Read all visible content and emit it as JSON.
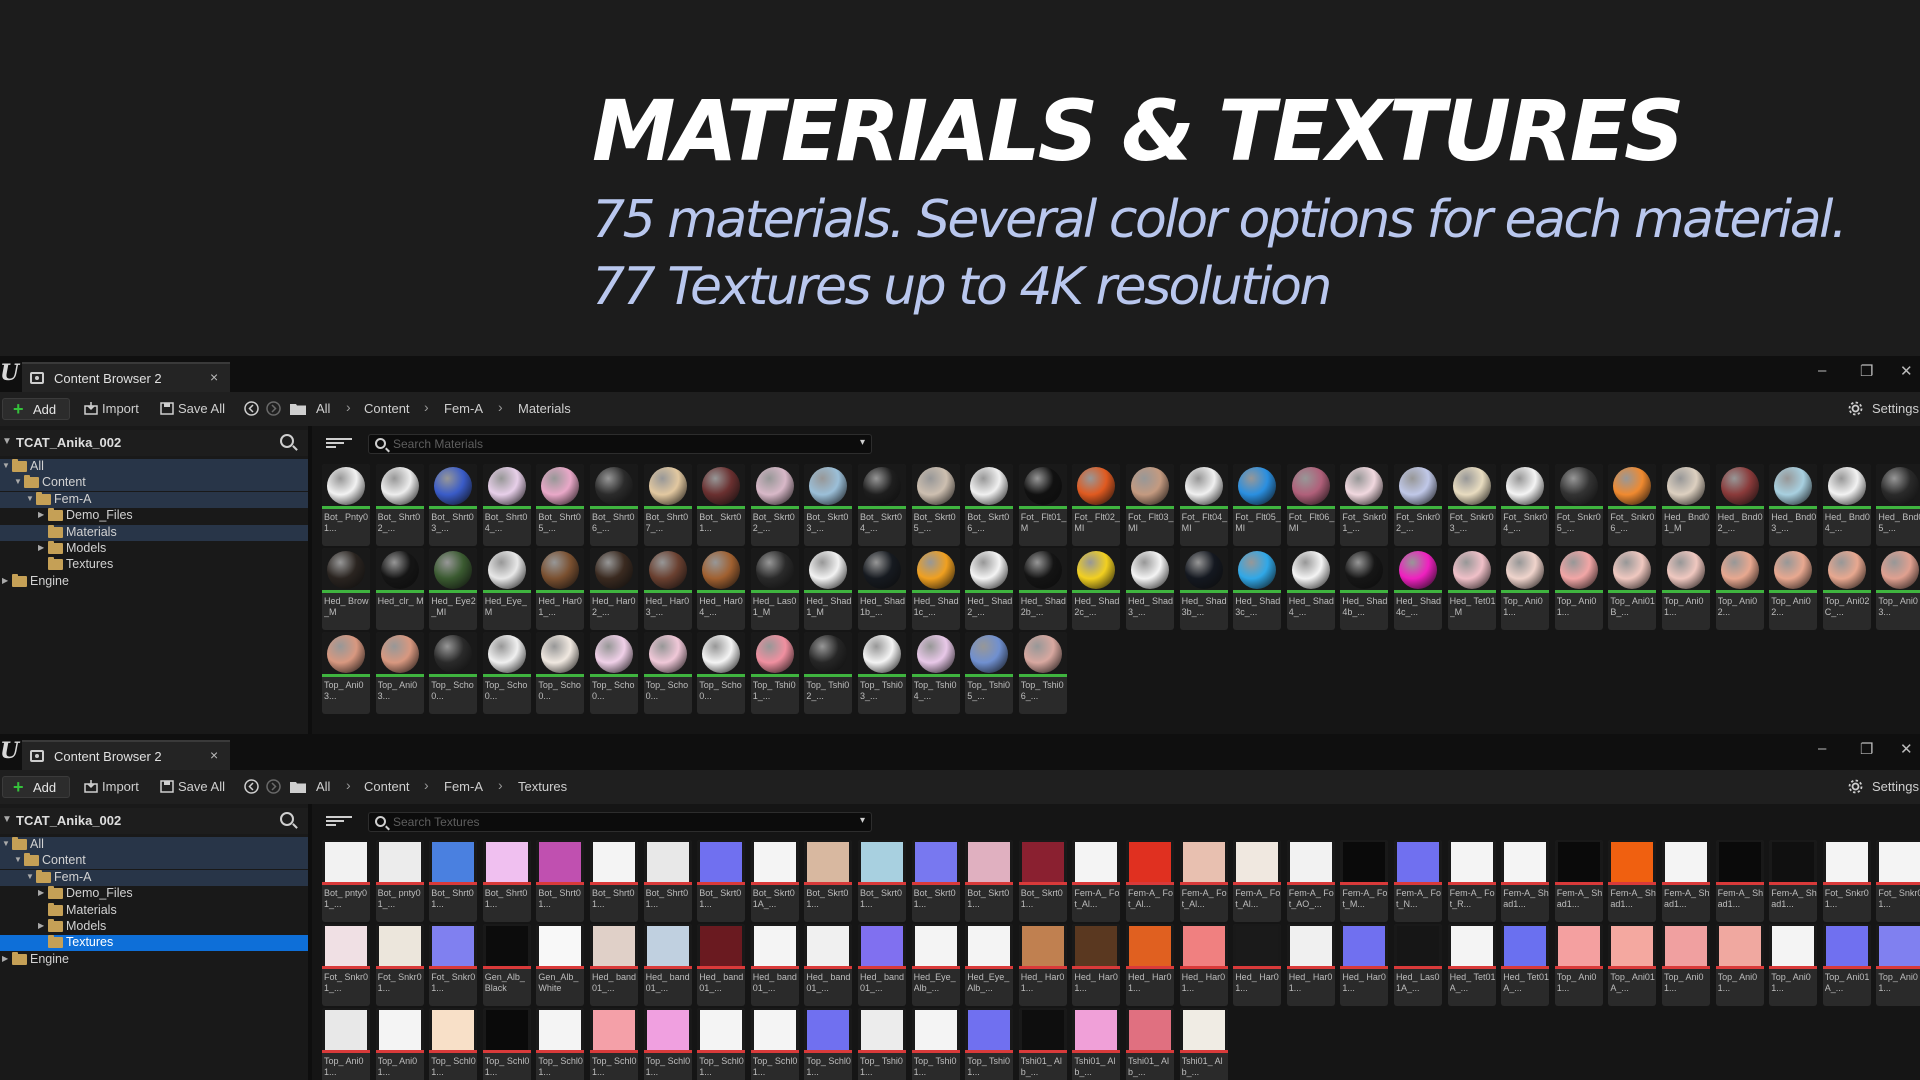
{
  "hero": {
    "title": "MATERIALS & TEXTURES",
    "line1": "75 materials. Several color options for each material.",
    "line2": "77 Textures up to 4K resolution"
  },
  "colors": {
    "material_bar": "#3fb43f",
    "texture_bar": "#d93a3a",
    "selection": "#0e6fd8",
    "hero_subtitle": "#b9c7ee"
  },
  "browser1": {
    "tab_label": "Content Browser 2",
    "tab_close": "×",
    "minimize": "–",
    "maximize": "❐",
    "close": "✕",
    "add_label": "Add",
    "import_label": "Import",
    "save_all_label": "Save All",
    "breadcrumb": [
      "All",
      "Content",
      "Fem-A",
      "Materials"
    ],
    "settings_label": "Settings",
    "project_name": "TCAT_Anika_002",
    "tree": [
      {
        "label": "All",
        "depth": 0,
        "expanded": true,
        "state": "hl"
      },
      {
        "label": "Content",
        "depth": 1,
        "expanded": true,
        "state": "hl"
      },
      {
        "label": "Fem-A",
        "depth": 2,
        "expanded": true,
        "state": "hl"
      },
      {
        "label": "Demo_Files",
        "depth": 3,
        "expanded": false,
        "state": ""
      },
      {
        "label": "Materials",
        "depth": 3,
        "expanded": null,
        "state": "hl"
      },
      {
        "label": "Models",
        "depth": 3,
        "expanded": false,
        "state": ""
      },
      {
        "label": "Textures",
        "depth": 3,
        "expanded": null,
        "state": ""
      },
      {
        "label": "Engine",
        "depth": 0,
        "expanded": false,
        "state": ""
      }
    ],
    "search_placeholder": "Search Materials",
    "assets": [
      {
        "name": "Bot_ Pnty01...",
        "color": "#f2f2f2"
      },
      {
        "name": "Bot_ Shrt02_...",
        "color": "#ededed"
      },
      {
        "name": "Bot_ Shrt03_...",
        "color": "#3a5cc8"
      },
      {
        "name": "Bot_ Shrt04_...",
        "color": "#e7cfe9"
      },
      {
        "name": "Bot_ Shrt05_...",
        "color": "#e9a8c8"
      },
      {
        "name": "Bot_ Shrt06_...",
        "color": "#2b2b2b"
      },
      {
        "name": "Bot_ Shrt07_...",
        "color": "#e2c8a0"
      },
      {
        "name": "Bot_ Skrt01...",
        "color": "#6a3030"
      },
      {
        "name": "Bot_ Skrt02_...",
        "color": "#d8b8c8"
      },
      {
        "name": "Bot_ Skrt03_...",
        "color": "#9bbfd8"
      },
      {
        "name": "Bot_ Skrt04_...",
        "color": "#1e1e1e"
      },
      {
        "name": "Bot_ Skrt05_...",
        "color": "#cdbfb0"
      },
      {
        "name": "Bot_ Skrt06_...",
        "color": "#f0f0f0"
      },
      {
        "name": "Fot_ Flt01_M",
        "color": "#111111"
      },
      {
        "name": "Fot_ Flt02_MI",
        "color": "#e05a20"
      },
      {
        "name": "Fot_ Flt03_MI",
        "color": "#c49a80"
      },
      {
        "name": "Fot_ Flt04_MI",
        "color": "#f0f0f0"
      },
      {
        "name": "Fot_ Flt05_MI",
        "color": "#2a8fe0"
      },
      {
        "name": "Fot_ Flt06_MI",
        "color": "#b0607a"
      },
      {
        "name": "Fot_ Snkr01_...",
        "color": "#f1d8df"
      },
      {
        "name": "Fot_ Snkr02_...",
        "color": "#c0c8e8"
      },
      {
        "name": "Fot_ Snkr03_...",
        "color": "#e8dcc0"
      },
      {
        "name": "Fot_ Snkr04_...",
        "color": "#f4f4f4"
      },
      {
        "name": "Fot_ Snkr05_...",
        "color": "#333333"
      },
      {
        "name": "Fot_ Snkr06_...",
        "color": "#f08a30"
      },
      {
        "name": "Hed_ Bnd01_M",
        "color": "#ddd0c0"
      },
      {
        "name": "Hed_ Bnd02_...",
        "color": "#8a3a3a"
      },
      {
        "name": "Hed_ Bnd03_...",
        "color": "#a8d0e0"
      },
      {
        "name": "Hed_ Bnd04_...",
        "color": "#f2f2f2"
      },
      {
        "name": "Hed_ Bnd05_...",
        "color": "#2a2a2a"
      },
      {
        "name": "Hed_ Brow_M",
        "color": "#2a2420"
      },
      {
        "name": "Hed_clr_ M",
        "color": "#151515"
      },
      {
        "name": "Hed_ Eye2_MI",
        "color": "#3a5a30"
      },
      {
        "name": "Hed_Eye_ M",
        "color": "#e8e8e8"
      },
      {
        "name": "Hed_ Har01_...",
        "color": "#7a5030"
      },
      {
        "name": "Hed_ Har02_...",
        "color": "#3a2a20"
      },
      {
        "name": "Hed_ Har03_...",
        "color": "#6a4030"
      },
      {
        "name": "Hed_ Har04_...",
        "color": "#a06030"
      },
      {
        "name": "Hed_ Las01_M",
        "color": "#2a2a2a"
      },
      {
        "name": "Hed_ Shad1_M",
        "color": "#f2f2f2"
      },
      {
        "name": "Hed_ Shad1b_...",
        "color": "#161a20"
      },
      {
        "name": "Hed_ Shad1c_...",
        "color": "#f0a020"
      },
      {
        "name": "Hed_ Shad2_...",
        "color": "#f4f4f4"
      },
      {
        "name": "Hed_ Shad2b_...",
        "color": "#141414"
      },
      {
        "name": "Hed_ Shad2c_...",
        "color": "#f2d020"
      },
      {
        "name": "Hed_ Shad3_...",
        "color": "#f4f4f4"
      },
      {
        "name": "Hed_ Shad3b_...",
        "color": "#141820"
      },
      {
        "name": "Hed_ Shad3c_...",
        "color": "#30a8e8"
      },
      {
        "name": "Hed_ Shad4_...",
        "color": "#f4f4f4"
      },
      {
        "name": "Hed_ Shad4b_...",
        "color": "#161616"
      },
      {
        "name": "Hed_ Shad4c_...",
        "color": "#f020c0"
      },
      {
        "name": "Hed_ Tet01_M",
        "color": "#f0c0c8"
      },
      {
        "name": "Top_ Ani01...",
        "color": "#f0d4cc"
      },
      {
        "name": "Top_ Ani01...",
        "color": "#f2a6a6"
      },
      {
        "name": "Top_ Ani01B_...",
        "color": "#f0c8c0"
      },
      {
        "name": "Top_ Ani01...",
        "color": "#f0c8c0"
      },
      {
        "name": "Top_ Ani02...",
        "color": "#e8a890"
      },
      {
        "name": "Top_ Ani02...",
        "color": "#e8a890"
      },
      {
        "name": "Top_ Ani02C_...",
        "color": "#e8a890"
      },
      {
        "name": "Top_ Ani03...",
        "color": "#e0a090"
      },
      {
        "name": "Top_ Ani03...",
        "color": "#d89880"
      },
      {
        "name": "Top_ Ani03...",
        "color": "#d89880"
      },
      {
        "name": "Top_ Scho0...",
        "color": "#2a2a2a"
      },
      {
        "name": "Top_ Scho0...",
        "color": "#f0f0f0"
      },
      {
        "name": "Top_ Scho0...",
        "color": "#f0e8e0"
      },
      {
        "name": "Top_ Scho0...",
        "color": "#f0d0e8"
      },
      {
        "name": "Top_ Scho0...",
        "color": "#f0c8d8"
      },
      {
        "name": "Top_ Scho0...",
        "color": "#f4f4f4"
      },
      {
        "name": "Top_ Tshi01_...",
        "color": "#f090a0"
      },
      {
        "name": "Top_ Tshi02_...",
        "color": "#262626"
      },
      {
        "name": "Top_ Tshi03_...",
        "color": "#f4f4f4"
      },
      {
        "name": "Top_ Tshi04_...",
        "color": "#e8c8e8"
      },
      {
        "name": "Top_ Tshi05_...",
        "color": "#7090d0"
      },
      {
        "name": "Top_ Tshi06_...",
        "color": "#d8a8a0"
      }
    ]
  },
  "browser2": {
    "tab_label": "Content Browser 2",
    "tab_close": "×",
    "minimize": "–",
    "maximize": "❐",
    "close": "✕",
    "add_label": "Add",
    "import_label": "Import",
    "save_all_label": "Save All",
    "breadcrumb": [
      "All",
      "Content",
      "Fem-A",
      "Textures"
    ],
    "settings_label": "Settings",
    "project_name": "TCAT_Anika_002",
    "tree": [
      {
        "label": "All",
        "depth": 0,
        "expanded": true,
        "state": "hl"
      },
      {
        "label": "Content",
        "depth": 1,
        "expanded": true,
        "state": "hl"
      },
      {
        "label": "Fem-A",
        "depth": 2,
        "expanded": true,
        "state": "hl"
      },
      {
        "label": "Demo_Files",
        "depth": 3,
        "expanded": false,
        "state": ""
      },
      {
        "label": "Materials",
        "depth": 3,
        "expanded": null,
        "state": ""
      },
      {
        "label": "Models",
        "depth": 3,
        "expanded": false,
        "state": ""
      },
      {
        "label": "Textures",
        "depth": 3,
        "expanded": null,
        "state": "sel"
      },
      {
        "label": "Engine",
        "depth": 0,
        "expanded": false,
        "state": ""
      }
    ],
    "search_placeholder": "Search Textures",
    "assets": [
      {
        "name": "Bot_ pnty01_...",
        "color": "#f2f2f2"
      },
      {
        "name": "Bot_ pnty01_...",
        "color": "#ececec"
      },
      {
        "name": "Bot_ Shrt01...",
        "color": "#4a80e0"
      },
      {
        "name": "Bot_ Shrt01...",
        "color": "#f0c0f0"
      },
      {
        "name": "Bot_ Shrt01...",
        "color": "#c050b0"
      },
      {
        "name": "Bot_ Shrt01...",
        "color": "#f4f4f4"
      },
      {
        "name": "Bot_ Shrt01...",
        "color": "#e8e8e8"
      },
      {
        "name": "Bot_ Skrt01...",
        "color": "#7070f0"
      },
      {
        "name": "Bot_ Skrt01A_...",
        "color": "#f4f4f4"
      },
      {
        "name": "Bot_ Skrt01...",
        "color": "#d8b8a0"
      },
      {
        "name": "Bot_ Skrt01...",
        "color": "#a8d0e0"
      },
      {
        "name": "Bot_ Skrt01...",
        "color": "#7878f0"
      },
      {
        "name": "Bot_ Skrt01...",
        "color": "#e0b0c0"
      },
      {
        "name": "Bot_ Skrt01...",
        "color": "#8a2030"
      },
      {
        "name": "Fem-A_ Fot_Al...",
        "color": "#f4f4f4"
      },
      {
        "name": "Fem-A_ Fot_Al...",
        "color": "#e03020"
      },
      {
        "name": "Fem-A_ Fot_Al...",
        "color": "#e8c0b0"
      },
      {
        "name": "Fem-A_ Fot_Al...",
        "color": "#f0e8e0"
      },
      {
        "name": "Fem-A_ Fot_AO_...",
        "color": "#f2f2f2"
      },
      {
        "name": "Fem-A_ Fot_M...",
        "color": "#0a0a0a"
      },
      {
        "name": "Fem-A_ Fot_N...",
        "color": "#7070f0"
      },
      {
        "name": "Fem-A_ Fot_R...",
        "color": "#f4f4f4"
      },
      {
        "name": "Fem-A_ Shad1...",
        "color": "#f4f4f4"
      },
      {
        "name": "Fem-A_ Shad1...",
        "color": "#0a0a0a"
      },
      {
        "name": "Fem-A_ Shad1...",
        "color": "#f06010"
      },
      {
        "name": "Fem-A_ Shad1...",
        "color": "#f4f4f4"
      },
      {
        "name": "Fem-A_ Shad1...",
        "color": "#0a0a0a"
      },
      {
        "name": "Fem-A_ Shad1...",
        "color": "#101010"
      },
      {
        "name": "Fot_ Snkr01...",
        "color": "#f4f4f4"
      },
      {
        "name": "Fot_ Snkr01...",
        "color": "#f4f4f4"
      },
      {
        "name": "Fot_ Snkr01_...",
        "color": "#f0e0e4"
      },
      {
        "name": "Fot_ Snkr01...",
        "color": "#ece6dc"
      },
      {
        "name": "Fot_ Snkr01...",
        "color": "#8080f0"
      },
      {
        "name": "Gen_Alb_ Black",
        "color": "#0c0c0c"
      },
      {
        "name": "Gen_Alb_ White",
        "color": "#f8f8f8"
      },
      {
        "name": "Hed_ band01_...",
        "color": "#e0d0c8"
      },
      {
        "name": "Hed_ band01_...",
        "color": "#c0d0e0"
      },
      {
        "name": "Hed_ band01_...",
        "color": "#6a1a20"
      },
      {
        "name": "Hed_ band01_...",
        "color": "#f4f4f4"
      },
      {
        "name": "Hed_ band01_...",
        "color": "#f0f0f0"
      },
      {
        "name": "Hed_ band01_...",
        "color": "#8070f0"
      },
      {
        "name": "Hed_Eye_ Alb_...",
        "color": "#f4f4f4"
      },
      {
        "name": "Hed_Eye_ Alb_...",
        "color": "#f4f4f4"
      },
      {
        "name": "Hed_ Har01...",
        "color": "#c08050"
      },
      {
        "name": "Hed_ Har01...",
        "color": "#5a3820"
      },
      {
        "name": "Hed_ Har01...",
        "color": "#e06020"
      },
      {
        "name": "Hed_ Har01...",
        "color": "#f08080"
      },
      {
        "name": "Hed_ Har01...",
        "color": "#1a1a1a"
      },
      {
        "name": "Hed_ Har01...",
        "color": "#f0f0f0"
      },
      {
        "name": "Hed_ Har01...",
        "color": "#7070f0"
      },
      {
        "name": "Hed_ Las01A_...",
        "color": "#161616"
      },
      {
        "name": "Hed_ Tet01A_...",
        "color": "#f4f4f4"
      },
      {
        "name": "Hed_ Tet01A_...",
        "color": "#6a70f0"
      },
      {
        "name": "Top_ Ani01...",
        "color": "#f4a0a0"
      },
      {
        "name": "Top_ Ani01A_...",
        "color": "#f4a8a0"
      },
      {
        "name": "Top_ Ani01...",
        "color": "#f0a0a0"
      },
      {
        "name": "Top_ Ani01...",
        "color": "#f0a8a0"
      },
      {
        "name": "Top_ Ani01...",
        "color": "#f4f4f4"
      },
      {
        "name": "Top_ Ani01A_...",
        "color": "#7070f0"
      },
      {
        "name": "Top_ Ani01...",
        "color": "#8080f0"
      },
      {
        "name": "Top_ Ani01...",
        "color": "#e8e8e8"
      },
      {
        "name": "Top_ Ani01...",
        "color": "#f4f4f4"
      },
      {
        "name": "Top_ Schl01...",
        "color": "#f8e0c8"
      },
      {
        "name": "Top_ Schl01...",
        "color": "#0a0a0a"
      },
      {
        "name": "Top_ Schl01...",
        "color": "#f4f4f4"
      },
      {
        "name": "Top_ Schl01...",
        "color": "#f4a0a8"
      },
      {
        "name": "Top_ Schl01...",
        "color": "#f0a0e0"
      },
      {
        "name": "Top_ Schl01...",
        "color": "#f4f4f4"
      },
      {
        "name": "Top_ Schl01...",
        "color": "#f4f4f4"
      },
      {
        "name": "Top_ Schl01...",
        "color": "#7070f0"
      },
      {
        "name": "Top_ Tshi01...",
        "color": "#ececec"
      },
      {
        "name": "Top_ Tshi01...",
        "color": "#f4f4f4"
      },
      {
        "name": "Top_ Tshi01...",
        "color": "#7070f0"
      },
      {
        "name": "Tshi01_ Alb_...",
        "color": "#0e0e0e"
      },
      {
        "name": "Tshi01_ Alb_...",
        "color": "#f0a0d8"
      },
      {
        "name": "Tshi01_ Alb_...",
        "color": "#e07080"
      },
      {
        "name": "Tshi01_ Alb_...",
        "color": "#f0ece4"
      }
    ]
  }
}
